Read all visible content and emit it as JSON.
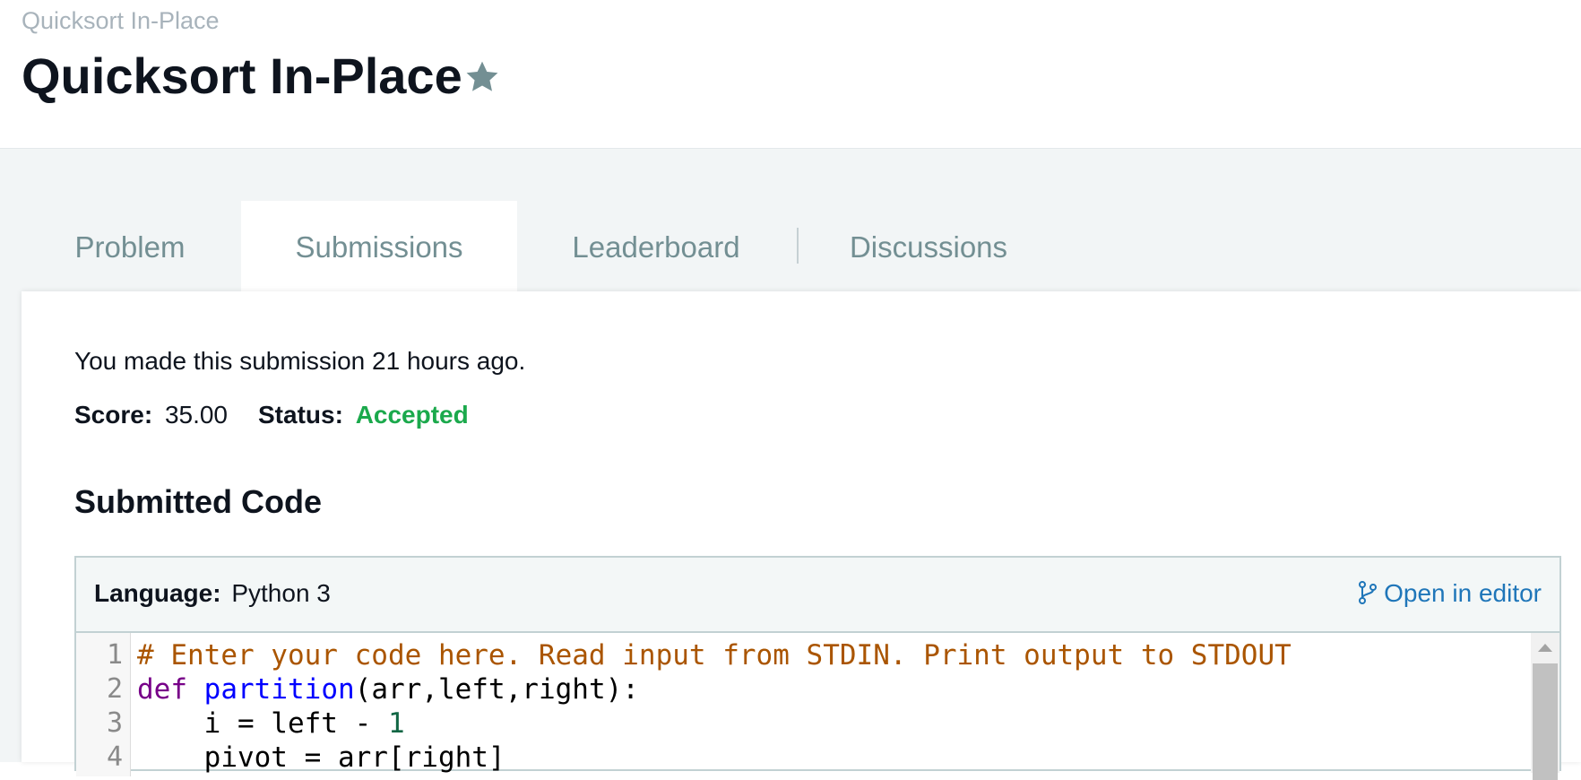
{
  "breadcrumb": "Quicksort In-Place",
  "page_title": "Quicksort In-Place",
  "tabs": [
    {
      "label": "Problem",
      "active": false
    },
    {
      "label": "Submissions",
      "active": true
    },
    {
      "label": "Leaderboard",
      "active": false
    },
    {
      "label": "Discussions",
      "active": false
    }
  ],
  "submission": {
    "note": "You made this submission 21 hours ago.",
    "score_label": "Score:",
    "score_value": "35.00",
    "status_label": "Status:",
    "status_value": "Accepted"
  },
  "code_section": {
    "title": "Submitted Code",
    "language_label": "Language:",
    "language_value": "Python 3",
    "open_editor_label": "Open in editor",
    "line_numbers": [
      "1",
      "2",
      "3",
      "4"
    ],
    "lines": [
      [
        {
          "t": "# Enter your code here. Read input from STDIN. Print output to STDOUT",
          "c": "comment"
        }
      ],
      [
        {
          "t": "def",
          "c": "keyword"
        },
        {
          "t": " ",
          "c": ""
        },
        {
          "t": "partition",
          "c": "def"
        },
        {
          "t": "(arr,left,right):",
          "c": ""
        }
      ],
      [
        {
          "t": "    i = left - ",
          "c": ""
        },
        {
          "t": "1",
          "c": "number"
        }
      ],
      [
        {
          "t": "    pivot = arr[right]",
          "c": ""
        }
      ]
    ]
  },
  "colors": {
    "accepted": "#1ba94c",
    "link": "#1f76b9",
    "star": "#738f93"
  }
}
